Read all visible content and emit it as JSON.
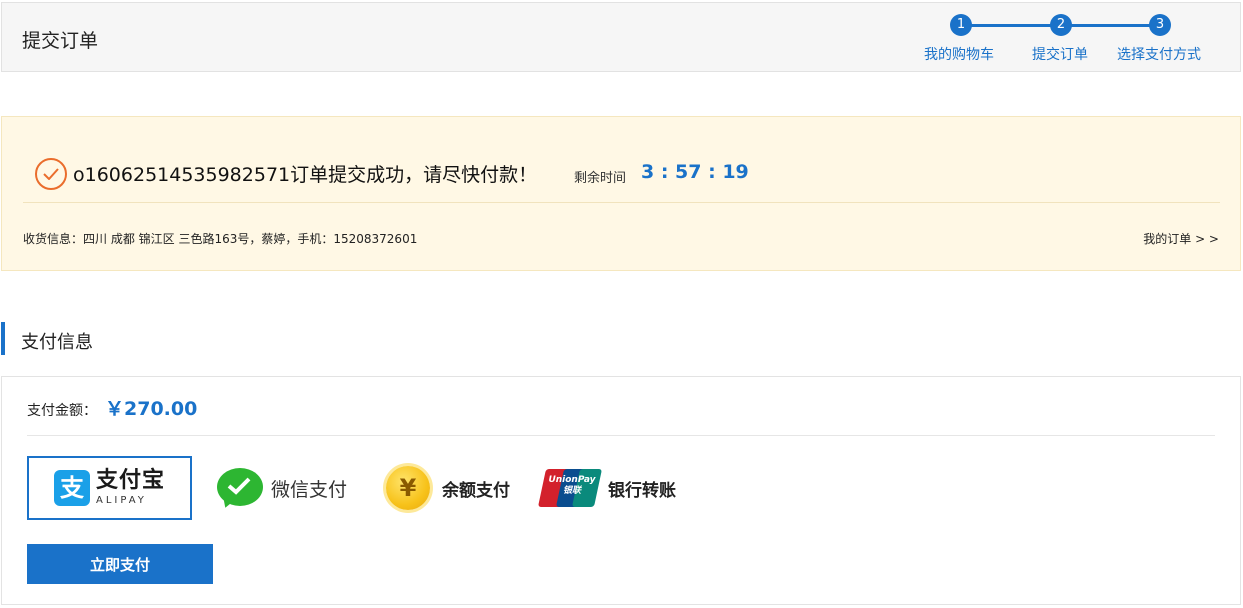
{
  "header": {
    "title": "提交订单",
    "steps": [
      {
        "num": "1",
        "label": "我的购物车"
      },
      {
        "num": "2",
        "label": "提交订单"
      },
      {
        "num": "3",
        "label": "选择支付方式"
      }
    ]
  },
  "notice": {
    "message": "o16062514535982571订单提交成功，请尽快付款！",
    "remaining_label": "剩余时间",
    "countdown": "3 : 57 : 19",
    "address": "收货信息：四川 成都 锦江区 三色路163号，蔡婷，手机：15208372601",
    "my_orders_link": "我的订单 > >"
  },
  "payment": {
    "section_title": "支付信息",
    "amount_label": "支付金额：",
    "amount_value": "￥270.00",
    "methods": [
      {
        "id": "alipay",
        "label_cn": "支付宝",
        "label_en": "ALIPAY",
        "selected": true
      },
      {
        "id": "wechat",
        "label": "微信支付",
        "selected": false
      },
      {
        "id": "balance",
        "label": "余额支付",
        "selected": false
      },
      {
        "id": "bank",
        "label": "银行转账",
        "logo_text": "UnionPay 银联",
        "selected": false
      }
    ],
    "submit_label": "立即支付"
  },
  "colors": {
    "accent": "#1a72c9",
    "notice_bg": "#fff8e5",
    "success_icon": "#ea6d2c"
  },
  "icons": [
    "check-circle-icon",
    "alipay-icon",
    "wechat-icon",
    "yuan-coin-icon",
    "unionpay-icon"
  ]
}
